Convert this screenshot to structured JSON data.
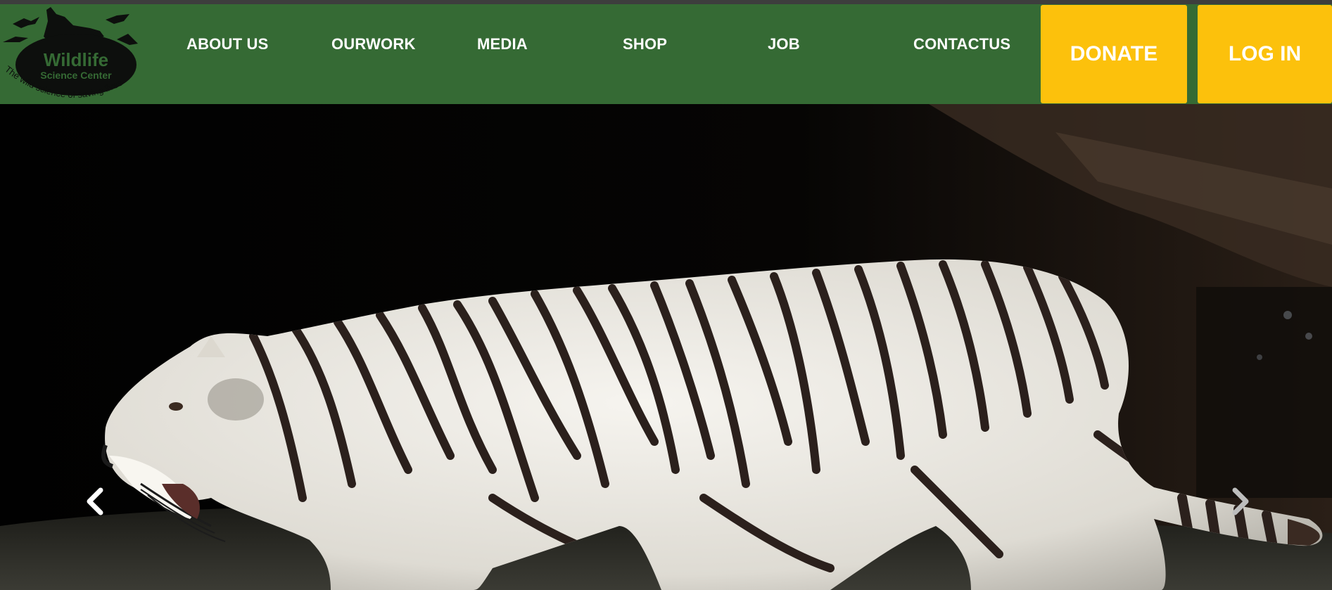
{
  "brand": {
    "name": "Wildlife",
    "subtitle": "Science Center",
    "tagline": "The wild science of saving lives",
    "colors": {
      "nav_bg": "#356a34",
      "cta_bg": "#fcc10c",
      "logo_dark": "#0d0f0d"
    }
  },
  "nav": {
    "items": [
      {
        "label": "ABOUT US"
      },
      {
        "label": "OURWORK"
      },
      {
        "label": "MEDIA"
      },
      {
        "label": "SHOP"
      },
      {
        "label": "JOB"
      },
      {
        "label": "CONTACTUS"
      }
    ]
  },
  "actions": {
    "donate_label": "DONATE",
    "login_label": "LOG IN"
  },
  "hero": {
    "prev_icon": "chevron-left-icon",
    "next_icon": "chevron-right-icon"
  }
}
